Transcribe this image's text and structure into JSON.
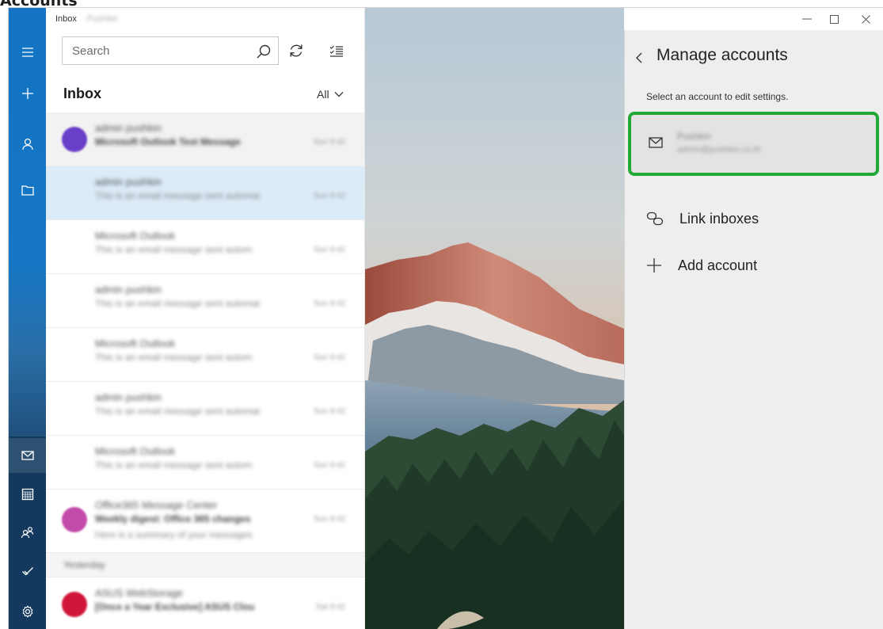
{
  "caption": {
    "text": "Accounts"
  },
  "window": {
    "titlebar_label": "Inbox",
    "titlebar_account": "Pushkin"
  },
  "rail": {
    "icons": [
      "hamburger-icon",
      "plus-icon",
      "person-icon",
      "folder-icon",
      "mail-icon",
      "calendar-icon",
      "people-icon",
      "todo-icon",
      "gear-icon"
    ]
  },
  "list": {
    "search": {
      "placeholder": "Search"
    },
    "heading": "Inbox",
    "filter": "All",
    "messages": [
      {
        "sender": "admin pushkin",
        "subject": "Microsoft Outlook Test Message",
        "time": "Sun 9:42",
        "avatar_color": "#6a3fc8",
        "state": "hover"
      },
      {
        "sender": "admin pushkin",
        "subject": "This is an email message sent automat",
        "time": "Sun 9:42",
        "avatar_color": "",
        "state": "selected"
      },
      {
        "sender": "Microsoft Outlook",
        "subject": "This is an email message sent autom",
        "time": "Sun 9:42",
        "avatar_color": "",
        "state": ""
      },
      {
        "sender": "admin pushkin",
        "subject": "This is an email message sent automat",
        "time": "Sun 9:42",
        "avatar_color": "",
        "state": ""
      },
      {
        "sender": "Microsoft Outlook",
        "subject": "This is an email message sent autom",
        "time": "Sun 9:42",
        "avatar_color": "",
        "state": ""
      },
      {
        "sender": "admin pushkin",
        "subject": "This is an email message sent automat",
        "time": "Sun 9:42",
        "avatar_color": "",
        "state": ""
      },
      {
        "sender": "Microsoft Outlook",
        "subject": "This is an email message sent autom",
        "time": "Sun 9:42",
        "avatar_color": "",
        "state": ""
      }
    ],
    "office_message": {
      "sender": "Office365 Message Center",
      "subject": "Weekly digest: Office 365 changes",
      "preview": "Here is a summary of your messages",
      "time": "Sun 9:42",
      "avatar_color": "#c24aa8"
    },
    "group_header": "Yesterday",
    "last_message": {
      "sender": "ASUS WebStorage",
      "subject": "[Once a Year Exclusive] ASUS Clou",
      "time": "Sat 9:42",
      "avatar_color": "#d0173a"
    }
  },
  "panel": {
    "title": "Manage accounts",
    "subtitle": "Select an account to edit settings.",
    "account": {
      "name": "Pushkin",
      "email": "admin@pushkin.co.th"
    },
    "link_inboxes": "Link inboxes",
    "add_account": "Add account",
    "highlight_color": "#21a837"
  }
}
